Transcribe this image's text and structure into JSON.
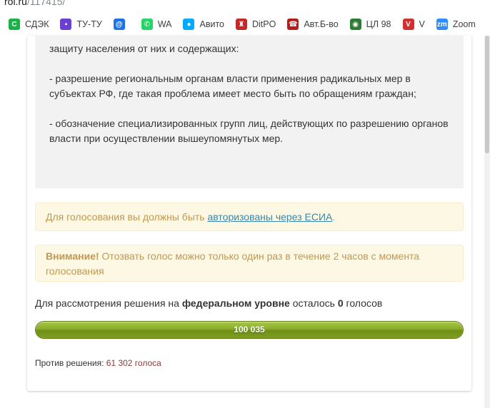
{
  "browser": {
    "url_host": "roi.ru",
    "url_path": "/117415/",
    "bookmarks": [
      {
        "label": "СДЭК",
        "icon": "cdek-icon",
        "color": "#1ab248",
        "glyph": "С"
      },
      {
        "label": "ТУ-ТУ",
        "icon": "tutu-icon",
        "color": "#6a3fd1",
        "glyph": "▪"
      },
      {
        "label": "",
        "icon": "mail-at-icon",
        "color": "#1a73e8",
        "glyph": "@"
      },
      {
        "label": "WA",
        "icon": "whatsapp-icon",
        "color": "#25d366",
        "glyph": "✆"
      },
      {
        "label": "Авито",
        "icon": "avito-icon",
        "color": "#00aaff",
        "glyph": "●"
      },
      {
        "label": "DitPO",
        "icon": "moscow-crest-icon",
        "color": "#c62828",
        "glyph": "♜"
      },
      {
        "label": "Авт.Б-во",
        "icon": "phone-icon",
        "color": "#b71c1c",
        "glyph": "☎"
      },
      {
        "label": "ЦЛ 98",
        "icon": "globe-icon",
        "color": "#2e7d32",
        "glyph": "◉"
      },
      {
        "label": "V",
        "icon": "vivaldi-icon",
        "color": "#d32f2f",
        "glyph": "V"
      },
      {
        "label": "Zoom",
        "icon": "zoom-icon",
        "color": "#2d8cff",
        "glyph": "zm"
      }
    ]
  },
  "petition": {
    "description": [
      "защиту населения от них и содержащих:",
      "- разрешение региональным органам власти применения радикальных мер в субъектах РФ, где такая проблема имеет место быть по обращениям граждан;",
      "- обозначение специализированных групп лиц, действующих по разрешению органов власти при осуществлении вышеупомянутых мер."
    ],
    "auth_alert": {
      "prefix": "Для голосования вы должны быть ",
      "link": "авторизованы через ЕСИА",
      "suffix": "."
    },
    "warn_alert": {
      "title": "Внимание!",
      "text": " Отозвать голос можно только один раз в течение 2 часов с момента голосования"
    },
    "remaining": {
      "prefix": "Для рассмотрения решения на ",
      "level": "федеральном уровне",
      "middle": " осталось ",
      "count": "0",
      "suffix": " голосов"
    },
    "votes_for": "100 035",
    "progress_fraction": 1.0,
    "against": {
      "label": "Против решения: ",
      "value": "61 302 голоса"
    }
  }
}
